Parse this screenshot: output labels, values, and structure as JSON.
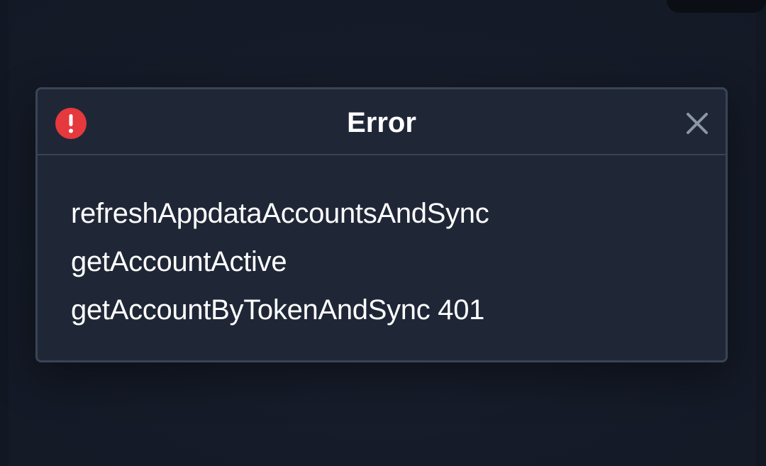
{
  "dialog": {
    "title": "Error",
    "icon": "alert-circle-icon",
    "close_icon": "close-icon",
    "accent_color": "#e5393d",
    "message_lines": [
      "refreshAppdataAccountsAndSync",
      "getAccountActive",
      "getAccountByTokenAndSync 401"
    ]
  }
}
